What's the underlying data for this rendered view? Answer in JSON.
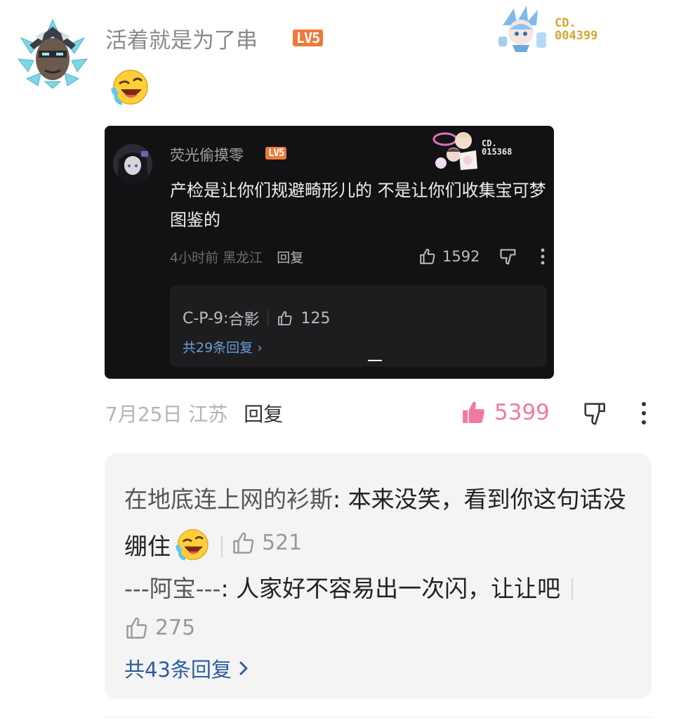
{
  "main_comment": {
    "username": "活着就是为了串",
    "level": "LV5",
    "emoji": "laughing-tears-emoji",
    "cd_label": "CD.",
    "cd_number": "004399",
    "date": "7月25日",
    "location": "江苏",
    "reply_label": "回复",
    "like_count": "5399"
  },
  "embedded_comment": {
    "username": "荧光偷摸零",
    "level": "LV5",
    "cd_label": "CD.",
    "cd_number": "015368",
    "text": "产检是让你们规避畸形儿的 不是让你们收集宝可梦图鉴的",
    "time": "4小时前",
    "location": "黑龙江",
    "reply_label": "回复",
    "like_count": "1592",
    "sub_reply": {
      "author": "C-P-9",
      "text": "合影",
      "likes": "125"
    },
    "total_replies": "共29条回复"
  },
  "replies": [
    {
      "author": "在地底连上网的衫斯",
      "text": "本来没笑，看到你这句话没绷住",
      "likes": "521"
    },
    {
      "author": "---阿宝---",
      "text": "人家好不容易出一次闪，让让吧",
      "likes": "275"
    }
  ],
  "total_replies": "共43条回复",
  "colors": {
    "like_active": "#f1799d",
    "level_badge": "#ee7a39",
    "link_blue": "#2b5d9a",
    "dark_bg": "#121214"
  }
}
